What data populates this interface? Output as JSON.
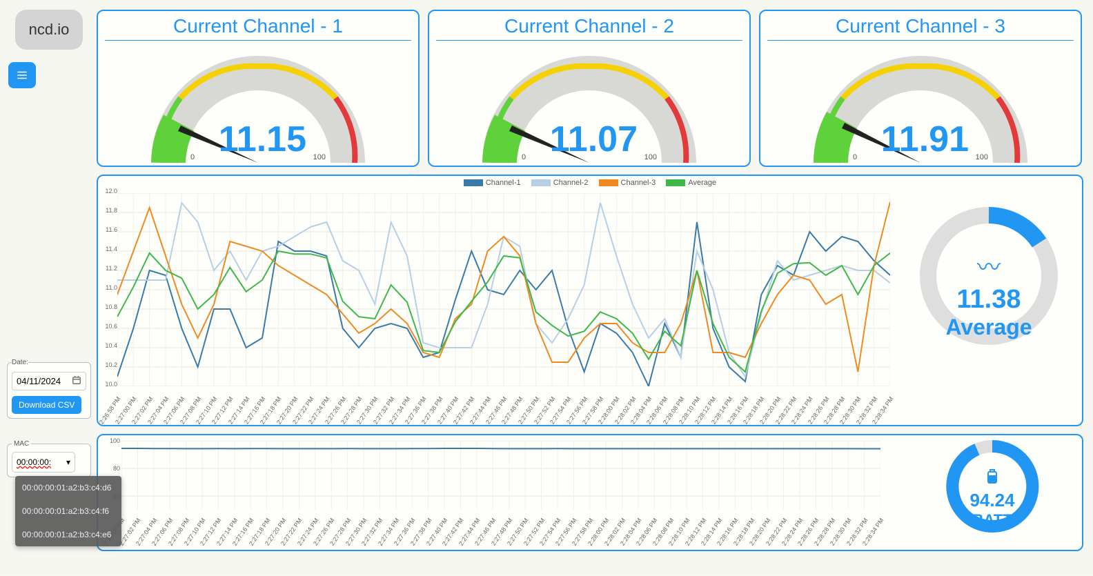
{
  "brand": "ncd.io",
  "gauges": [
    {
      "title": "Current Channel - 1",
      "value": "11.15",
      "min": "0",
      "max": "100"
    },
    {
      "title": "Current Channel - 2",
      "value": "11.07",
      "min": "0",
      "max": "100"
    },
    {
      "title": "Current Channel - 3",
      "value": "11.91",
      "min": "0",
      "max": "100"
    }
  ],
  "legend": {
    "ch1": "Channel-1",
    "ch2": "Channel-2",
    "ch3": "Channel-3",
    "avg": "Average"
  },
  "colors": {
    "ch1": "#3a7aa8",
    "ch2": "#b6cfe6",
    "ch3": "#f08a1e",
    "avg": "#3fb847",
    "accent": "#2196f3",
    "gauge_green": "#5fd13a",
    "gauge_yellow": "#f5d100",
    "gauge_red": "#e23a3a",
    "gauge_gray": "#d8d8d4"
  },
  "average": {
    "value": "11.38",
    "label": "Average"
  },
  "battery": {
    "value": "94.24",
    "label": "BATT"
  },
  "date_panel": {
    "label": "Date:",
    "value": "04/11/2024",
    "download": "Download CSV"
  },
  "mac_panel": {
    "label": "MAC",
    "selected": "00:00:00:",
    "options": [
      "00:00:00:01:a2:b3:c4:d6",
      "00:00:00:01:a2:b3:c4:f6",
      "00:00:00:01:a2:b3:c4:e6"
    ]
  },
  "chart_data": {
    "type": "line",
    "xlabel": "",
    "ylabel": "",
    "ylim": [
      10.0,
      12.0
    ],
    "y_ticks": [
      10.0,
      10.2,
      10.4,
      10.6,
      10.8,
      11.0,
      11.2,
      11.4,
      11.6,
      11.8,
      12.0
    ],
    "categories": [
      "2:26:58 PM",
      "2:27:00 PM",
      "2:27:02 PM",
      "2:27:04 PM",
      "2:27:06 PM",
      "2:27:08 PM",
      "2:27:10 PM",
      "2:27:12 PM",
      "2:27:14 PM",
      "2:27:16 PM",
      "2:27:18 PM",
      "2:27:20 PM",
      "2:27:22 PM",
      "2:27:24 PM",
      "2:27:26 PM",
      "2:27:28 PM",
      "2:27:30 PM",
      "2:27:32 PM",
      "2:27:34 PM",
      "2:27:36 PM",
      "2:27:38 PM",
      "2:27:40 PM",
      "2:27:42 PM",
      "2:27:44 PM",
      "2:27:46 PM",
      "2:27:48 PM",
      "2:27:50 PM",
      "2:27:52 PM",
      "2:27:54 PM",
      "2:27:56 PM",
      "2:27:58 PM",
      "2:28:00 PM",
      "2:28:02 PM",
      "2:28:04 PM",
      "2:28:06 PM",
      "2:28:08 PM",
      "2:28:10 PM",
      "2:28:12 PM",
      "2:28:14 PM",
      "2:28:16 PM",
      "2:28:18 PM",
      "2:28:20 PM",
      "2:28:22 PM",
      "2:28:24 PM",
      "2:28:26 PM",
      "2:28:28 PM",
      "2:28:30 PM",
      "2:28:32 PM",
      "2:28:34 PM"
    ],
    "series": [
      {
        "name": "Channel-1",
        "color": "#3a7aa8",
        "values": [
          10.1,
          10.6,
          11.2,
          11.15,
          10.6,
          10.2,
          10.8,
          10.8,
          10.4,
          10.5,
          11.5,
          11.4,
          11.4,
          11.35,
          10.6,
          10.4,
          10.6,
          10.65,
          10.6,
          10.3,
          10.35,
          10.9,
          11.4,
          11.0,
          10.95,
          11.2,
          11.0,
          11.2,
          10.6,
          10.15,
          10.65,
          10.55,
          10.35,
          10.0,
          10.65,
          10.3,
          11.7,
          10.6,
          10.2,
          10.05,
          10.95,
          11.25,
          11.15,
          11.6,
          11.4,
          11.55,
          11.5,
          11.3,
          11.15
        ]
      },
      {
        "name": "Channel-2",
        "color": "#b6cfe6",
        "values": [
          11.1,
          11.1,
          11.1,
          11.1,
          11.9,
          11.7,
          11.2,
          11.4,
          11.1,
          11.4,
          11.45,
          11.55,
          11.65,
          11.7,
          11.3,
          11.2,
          10.85,
          11.7,
          11.35,
          10.45,
          10.4,
          10.4,
          10.4,
          10.85,
          11.55,
          11.45,
          10.65,
          10.45,
          10.7,
          11.05,
          11.9,
          11.35,
          10.85,
          10.5,
          10.7,
          10.3,
          11.4,
          11.0,
          10.35,
          10.1,
          10.75,
          11.3,
          11.1,
          11.15,
          11.2,
          11.25,
          11.2,
          11.2,
          11.07
        ]
      },
      {
        "name": "Channel-3",
        "color": "#f08a1e",
        "values": [
          10.95,
          11.4,
          11.85,
          11.35,
          10.85,
          10.5,
          10.85,
          11.5,
          11.45,
          11.4,
          11.25,
          11.15,
          11.05,
          10.95,
          10.75,
          10.55,
          10.65,
          10.8,
          10.65,
          10.35,
          10.3,
          10.7,
          10.85,
          11.4,
          11.55,
          11.35,
          10.65,
          10.25,
          10.25,
          10.5,
          10.65,
          10.65,
          10.45,
          10.35,
          10.35,
          10.65,
          11.2,
          10.35,
          10.35,
          10.3,
          10.65,
          10.95,
          11.15,
          11.1,
          10.85,
          10.95,
          10.15,
          11.25,
          11.91
        ]
      },
      {
        "name": "Average",
        "color": "#3fb847",
        "values": [
          10.72,
          11.03,
          11.38,
          11.2,
          11.12,
          10.8,
          10.95,
          11.23,
          10.98,
          11.1,
          11.4,
          11.37,
          11.37,
          11.33,
          10.88,
          10.72,
          10.7,
          11.05,
          10.87,
          10.37,
          10.35,
          10.67,
          10.88,
          11.08,
          11.35,
          11.33,
          10.77,
          10.63,
          10.52,
          10.57,
          10.77,
          10.7,
          10.55,
          10.28,
          10.57,
          10.42,
          11.2,
          10.65,
          10.3,
          10.15,
          10.78,
          11.17,
          11.27,
          11.28,
          11.15,
          11.25,
          10.95,
          11.25,
          11.38
        ]
      }
    ]
  },
  "battery_chart": {
    "type": "line",
    "ylim": [
      0,
      100
    ],
    "y_ticks": [
      60,
      80,
      100
    ],
    "categories": [
      "2:27:00 PM",
      "2:27:02 PM",
      "2:27:04 PM",
      "2:27:06 PM",
      "2:27:08 PM",
      "2:27:10 PM",
      "2:27:12 PM",
      "2:27:14 PM",
      "2:27:16 PM",
      "2:27:18 PM",
      "2:27:20 PM",
      "2:27:22 PM",
      "2:27:24 PM",
      "2:27:26 PM",
      "2:27:28 PM",
      "2:27:30 PM",
      "2:27:32 PM",
      "2:27:34 PM",
      "2:27:36 PM",
      "2:27:38 PM",
      "2:27:40 PM",
      "2:27:42 PM",
      "2:27:44 PM",
      "2:27:46 PM",
      "2:27:48 PM",
      "2:27:50 PM",
      "2:27:52 PM",
      "2:27:54 PM",
      "2:27:56 PM",
      "2:27:58 PM",
      "2:28:00 PM",
      "2:28:02 PM",
      "2:28:04 PM",
      "2:28:06 PM",
      "2:28:08 PM",
      "2:28:10 PM",
      "2:28:12 PM",
      "2:28:14 PM",
      "2:28:16 PM",
      "2:28:18 PM",
      "2:28:20 PM",
      "2:28:22 PM",
      "2:28:24 PM",
      "2:28:26 PM",
      "2:28:28 PM",
      "2:28:30 PM",
      "2:28:32 PM",
      "2:28:34 PM"
    ],
    "values": [
      94.5,
      94.5,
      94.4,
      94.4,
      94.3,
      94.3,
      94.4,
      94.3,
      94.4,
      94.4,
      94.3,
      94.3,
      94.3,
      94.3,
      94.4,
      94.3,
      94.3,
      94.3,
      94.4,
      94.4,
      94.5,
      94.5,
      94.5,
      94.4,
      94.3,
      94.3,
      94.3,
      94.4,
      94.3,
      94.3,
      94.3,
      94.3,
      94.3,
      94.3,
      94.3,
      94.3,
      94.3,
      94.3,
      94.3,
      94.3,
      94.3,
      94.3,
      94.3,
      94.3,
      94.3,
      94.3,
      94.25,
      94.24
    ]
  }
}
